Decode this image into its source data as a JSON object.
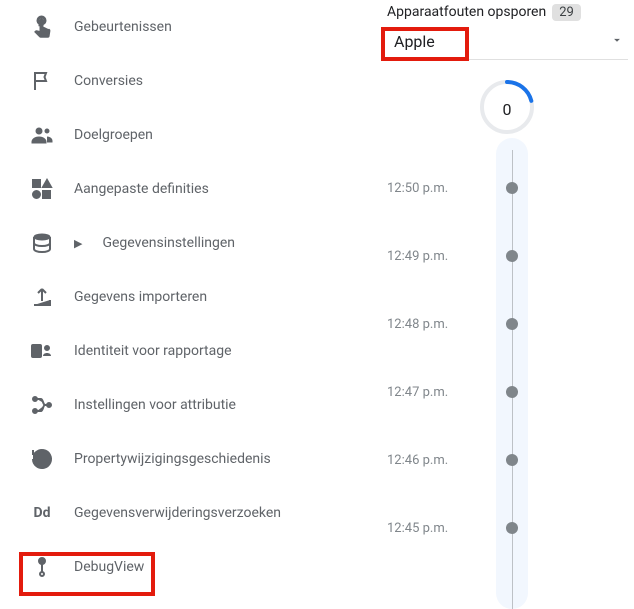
{
  "nav": {
    "items": [
      {
        "label": "Gebeurtenissen",
        "name": "sidebar-item-events",
        "icon": "touch-icon"
      },
      {
        "label": "Conversies",
        "name": "sidebar-item-conversions",
        "icon": "flag-icon"
      },
      {
        "label": "Doelgroepen",
        "name": "sidebar-item-audiences",
        "icon": "people-icon"
      },
      {
        "label": "Aangepaste definities",
        "name": "sidebar-item-custom-definitions",
        "icon": "shapes-icon"
      },
      {
        "label": "Gegevensinstellingen",
        "name": "sidebar-item-data-settings",
        "icon": "database-icon",
        "expandable": true
      },
      {
        "label": "Gegevens importeren",
        "name": "sidebar-item-data-import",
        "icon": "upload-icon"
      },
      {
        "label": "Identiteit voor rapportage",
        "name": "sidebar-item-reporting-identity",
        "icon": "identity-icon"
      },
      {
        "label": "Instellingen voor attributie",
        "name": "sidebar-item-attribution-settings",
        "icon": "attribution-icon"
      },
      {
        "label": "Propertywijzigingsgeschiedenis",
        "name": "sidebar-item-property-change-history",
        "icon": "history-icon"
      },
      {
        "label": "Gegevensverwijderingsverzoeken",
        "name": "sidebar-item-data-deletion-requests",
        "icon": "dd-text-icon"
      },
      {
        "label": "DebugView",
        "name": "sidebar-item-debugview",
        "icon": "debug-icon"
      }
    ]
  },
  "header": {
    "devices_label": "Apparaatfouten opsporen",
    "devices_count": "29",
    "selected_device": "Apple"
  },
  "timeline": {
    "counter": "0",
    "entries": [
      {
        "time": "12:50 p.m."
      },
      {
        "time": "12:49 p.m."
      },
      {
        "time": "12:48 p.m."
      },
      {
        "time": "12:47 p.m."
      },
      {
        "time": "12:46 p.m."
      },
      {
        "time": "12:45 p.m."
      }
    ]
  },
  "highlight_color": "#e31b0d"
}
